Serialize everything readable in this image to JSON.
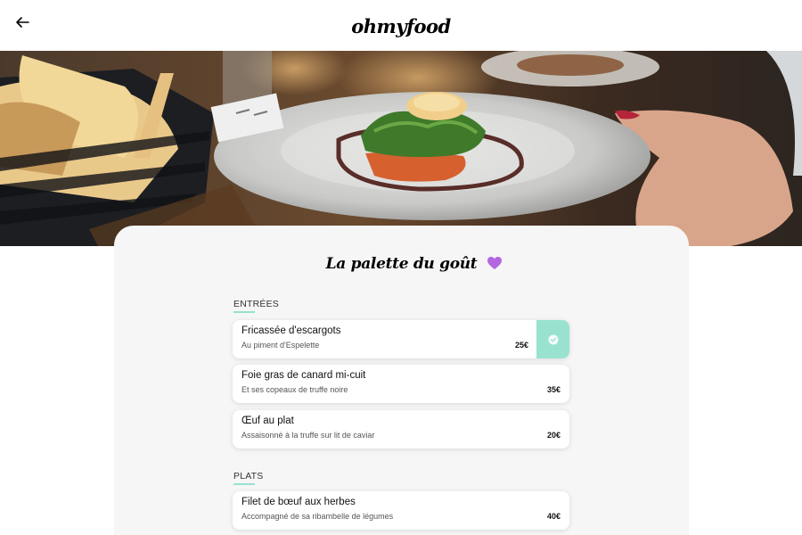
{
  "header": {
    "logo": "ohmyfood",
    "back_icon": "arrow-left-icon"
  },
  "hero": {
    "image": "plated-dish-photo"
  },
  "restaurant": {
    "name": "La palette du goût",
    "favorite_icon": "heart-icon",
    "favorite_color": "#b366e0"
  },
  "sections": [
    {
      "label": "ENTRÉES",
      "dishes": [
        {
          "name": "Fricassée d'escargots",
          "description": "Au piment d'Espelette",
          "price": "25€",
          "selected": true
        },
        {
          "name": "Foie gras de canard mi-cuit",
          "description": "Et ses copeaux de truffe noire",
          "price": "35€",
          "selected": false
        },
        {
          "name": "Œuf au plat",
          "description": "Assaisonné à la truffe sur lit de caviar",
          "price": "20€",
          "selected": false
        }
      ]
    },
    {
      "label": "PLATS",
      "dishes": [
        {
          "name": "Filet de bœuf aux herbes",
          "description": "Accompagné de sa ribambelle de légumes",
          "price": "40€",
          "selected": false
        }
      ]
    }
  ],
  "colors": {
    "accent": "#99e2d0",
    "card_bg": "#f6f6f6",
    "check_icon": "check-circle-icon"
  }
}
